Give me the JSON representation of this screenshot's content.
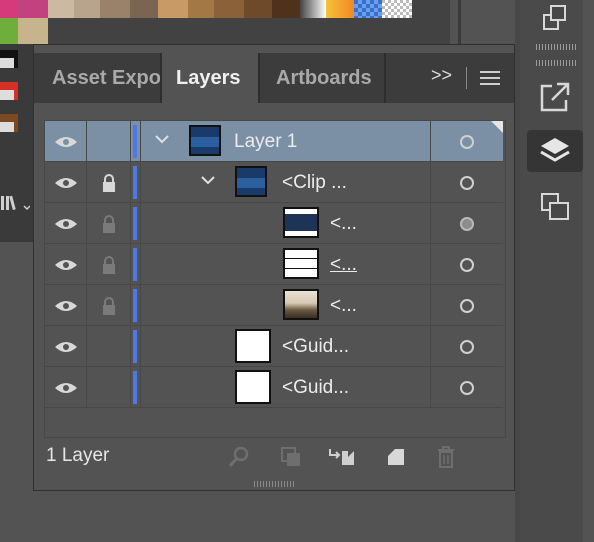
{
  "colors": {
    "accent": "#4d78ea",
    "selected_row": "#7b8fa5",
    "panel_bg": "#535353",
    "tabbar_bg": "#3c3c3c"
  },
  "tabs": [
    {
      "label": "Asset Expo",
      "active": false
    },
    {
      "label": "Layers",
      "active": true
    },
    {
      "label": "Artboards",
      "active": false
    }
  ],
  "tab_more_label": ">>",
  "layers": [
    {
      "name": "Layer 1",
      "depth": 0,
      "expanded": true,
      "locked": false,
      "thumb": "blue",
      "target": "empty",
      "selected": true
    },
    {
      "name": "<Clip ...",
      "depth": 1,
      "expanded": true,
      "locked": true,
      "thumb": "blue",
      "target": "empty",
      "selected": false
    },
    {
      "name": "<...",
      "depth": 2,
      "expanded": false,
      "locked": true,
      "thumb": "navy",
      "target": "filled",
      "selected": false
    },
    {
      "name": "<...",
      "depth": 2,
      "expanded": false,
      "locked": true,
      "thumb": "white-lines",
      "target": "empty",
      "selected": false,
      "underline": true
    },
    {
      "name": "<...",
      "depth": 2,
      "expanded": false,
      "locked": true,
      "thumb": "photo",
      "target": "empty",
      "selected": false
    },
    {
      "name": "<Guid...",
      "depth": 1,
      "expanded": false,
      "locked": false,
      "thumb": "white",
      "target": "empty",
      "selected": false
    },
    {
      "name": "<Guid...",
      "depth": 1,
      "expanded": false,
      "locked": false,
      "thumb": "white",
      "target": "empty",
      "selected": false
    }
  ],
  "footer": {
    "layer_count": "1 Layer"
  },
  "icons": {
    "visibility": "eye-icon",
    "lock": "lock-icon",
    "expand": "chevron-down-icon",
    "target": "target-circle-icon",
    "locate": "search-icon",
    "clip_mask": "clipping-mask-icon",
    "new_sublayer": "new-sublayer-icon",
    "new_layer": "new-layer-icon",
    "delete": "trash-icon",
    "panel_menu": "hamburger-menu-icon"
  }
}
